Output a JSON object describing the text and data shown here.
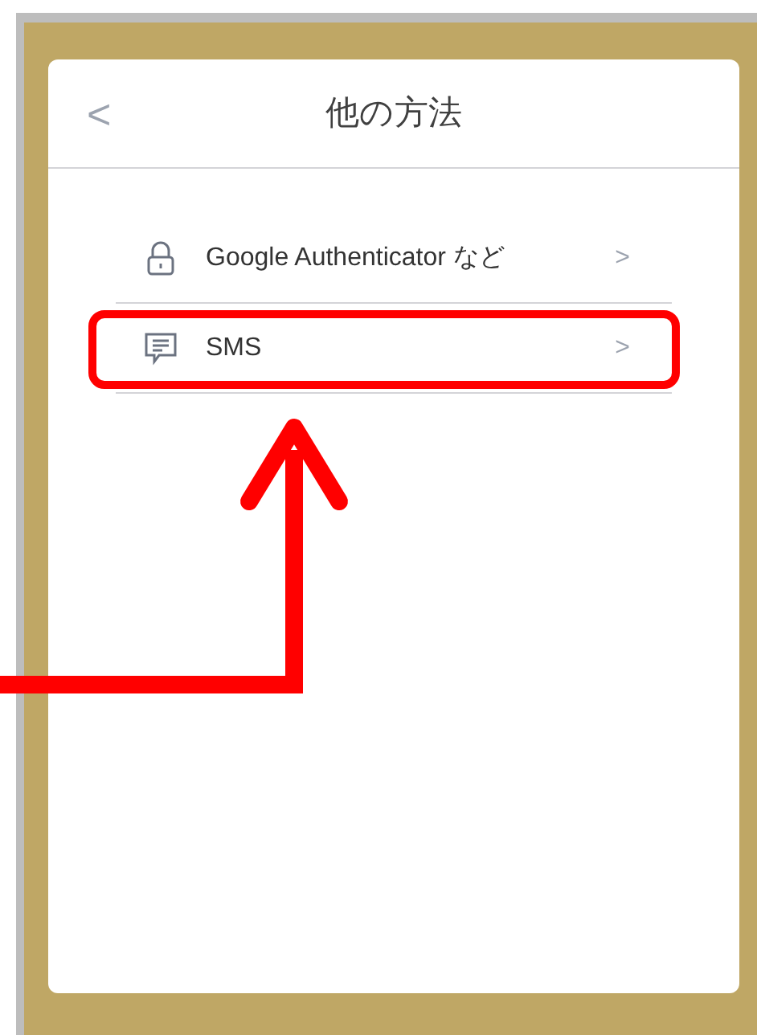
{
  "header": {
    "back": "<",
    "title": "他の方法"
  },
  "options": [
    {
      "kind": "lock",
      "label": "Google Authenticator など",
      "chevron": ">",
      "highlighted": false
    },
    {
      "kind": "message",
      "label": "SMS",
      "chevron": ">",
      "highlighted": true
    }
  ]
}
